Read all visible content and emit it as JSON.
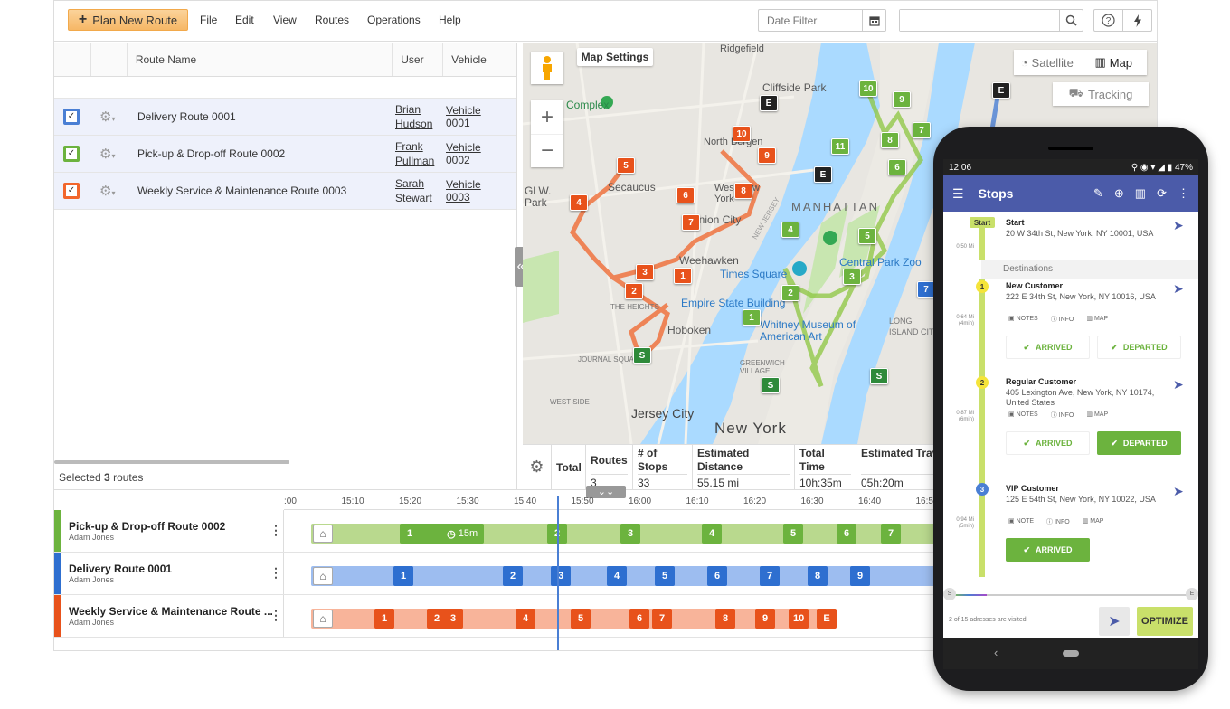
{
  "toolbar": {
    "plan_button": "Plan New Route",
    "menus": [
      "File",
      "Edit",
      "View",
      "Routes",
      "Operations",
      "Help"
    ],
    "date_filter_placeholder": "Date Filter",
    "search_placeholder": ""
  },
  "routes_table": {
    "headers": {
      "route_name": "Route Name",
      "user": "User",
      "vehicle": "Vehicle"
    },
    "rows": [
      {
        "name": "Delivery Route 0001",
        "user_first": "Brian",
        "user_last": "Hudson",
        "vehicle": "Vehicle 0001",
        "color": "#4a7fd4"
      },
      {
        "name": "Pick-up & Drop-off Route 0002",
        "user_first": "Frank",
        "user_last": "Pullman",
        "vehicle": "Vehicle 0002",
        "color": "#6cb33e"
      },
      {
        "name": "Weekly Service & Maintenance Route 0003",
        "user_first": "Sarah",
        "user_last": "Stewart",
        "vehicle": "Vehicle 0003",
        "color": "#f2662c"
      }
    ],
    "selected_prefix": "Selected",
    "selected_count": "3",
    "selected_suffix": "routes"
  },
  "map": {
    "settings_label": "Map Settings",
    "satellite_label": "Satellite",
    "map_label": "Map",
    "tracking_label": "Tracking",
    "place_labels": [
      "Ridgefield",
      "Cliffside Park",
      "North Bergen",
      "Secaucus",
      "West New York",
      "Union City",
      "Weehawken",
      "Times Square",
      "Empire State Building",
      "Hoboken",
      "Whitney Museum of American Art",
      "Jersey City",
      "New York",
      "MANHATTAN",
      "Central Park Zoo",
      "THE HEIGHTS",
      "JOURNAL SQUARE",
      "WEST SIDE",
      "GREENWICH VILLAGE",
      "ISLAND CITY",
      "LONG",
      "NEW JERSEY",
      "Gl W. Park",
      "Complex"
    ]
  },
  "summary": {
    "headers": [
      "Total",
      "Routes",
      "# of Stops",
      "Estimated Distance",
      "Total Time",
      "Estimated Travel Time"
    ],
    "values": [
      "",
      "3",
      "33",
      "55.15 mi",
      "10h:35m",
      "05h:20m"
    ]
  },
  "timeline": {
    "ticks": [
      ":00",
      "15:10",
      "15:20",
      "15:30",
      "15:40",
      "15:50",
      "16:00",
      "16:10",
      "16:20",
      "16:30",
      "16:40",
      "16:50"
    ],
    "rows": [
      {
        "title": "Pick-up & Drop-off Route 0002",
        "user": "Adam Jones",
        "color": "#6cb33e",
        "track": "#b9d98e",
        "stops": [
          "1",
          "2",
          "3",
          "4",
          "5",
          "6",
          "7"
        ],
        "wait_label": "15m"
      },
      {
        "title": "Delivery Route 0001",
        "user": "Adam Jones",
        "color": "#2e6fd0",
        "track": "#9dbdf0",
        "stops": [
          "1",
          "2",
          "3",
          "4",
          "5",
          "6",
          "7",
          "8",
          "9"
        ]
      },
      {
        "title": "Weekly Service & Maintenance Route ...",
        "user": "Adam Jones",
        "color": "#e8521b",
        "track": "#f8b49a",
        "stops": [
          "1",
          "2",
          "3",
          "4",
          "5",
          "6",
          "7",
          "8",
          "9",
          "10",
          "E"
        ]
      }
    ]
  },
  "phone": {
    "time": "12:06",
    "battery": "47%",
    "title": "Stops",
    "start_badge": "Start",
    "start_name": "Start",
    "start_address": "20 W 34th St, New York, NY 10001, USA",
    "destinations_label": "Destinations",
    "stops": [
      {
        "num": "1",
        "name": "New Customer",
        "address": "222 E 34th St, New York, NY 10016, USA",
        "dist": "0.64 Mi",
        "time": "(4min)",
        "arrived": "ARRIVED",
        "departed": "DEPARTED"
      },
      {
        "num": "2",
        "name": "Regular Customer",
        "address": "405 Lexington Ave, New York, NY 10174, United States",
        "dist": "0.87 Mi",
        "time": "(6min)",
        "arrived": "ARRIVED",
        "departed": "DEPARTED"
      },
      {
        "num": "3",
        "name": "VIP Customer",
        "address": "125 E 54th St, New York, NY 10022, USA",
        "dist": "0.94 Mi",
        "time": "(5min)",
        "arrived": "ARRIVED"
      }
    ],
    "start_dist": "0.50 Mi",
    "notes": "NOTES",
    "note": "NOTE",
    "info": "INFO",
    "map": "MAP",
    "footer_text": "2 of 15 adresses are visited.",
    "optimize": "OPTIMIZE"
  }
}
